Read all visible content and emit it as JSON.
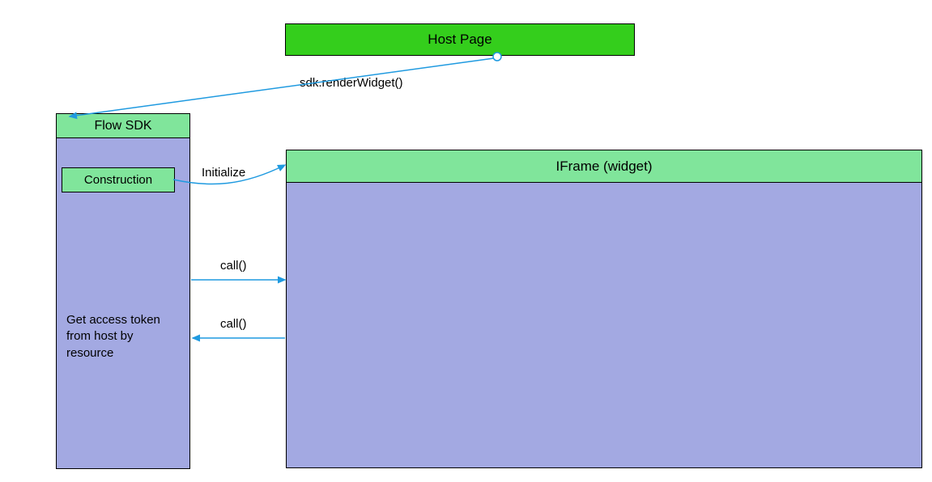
{
  "boxes": {
    "host_page": "Host Page",
    "flow_sdk": "Flow SDK",
    "construction": "Construction",
    "iframe": "IFrame (widget)"
  },
  "labels": {
    "render_widget": "sdk.renderWidget()",
    "initialize": "Initialize",
    "call1": "call()",
    "call2": "call()"
  },
  "text": {
    "flow_body": "Get access token from host by resource"
  },
  "colors": {
    "host_green": "#34ce1c",
    "panel_green": "#80e59b",
    "blue_fill": "#a3a9e2",
    "arrow": "#1f9ae0"
  }
}
